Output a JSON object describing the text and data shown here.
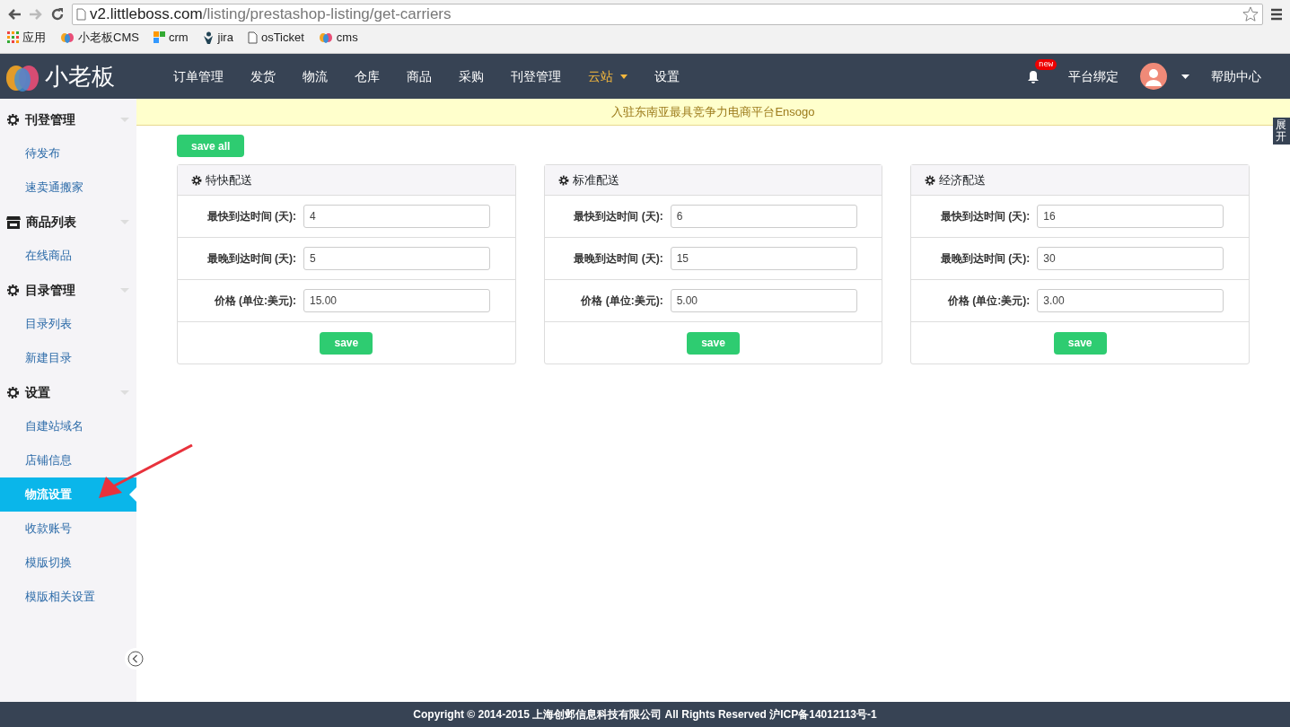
{
  "browser": {
    "url_host": "v2.littleboss.com",
    "url_path": "/listing/prestashop-listing/get-carriers",
    "bookmarks": [
      {
        "kind": "apps",
        "label": "应用"
      },
      {
        "kind": "logo",
        "label": "小老板CMS"
      },
      {
        "kind": "blocks",
        "label": "crm"
      },
      {
        "kind": "mascot",
        "label": "jira"
      },
      {
        "kind": "page",
        "label": "osTicket"
      },
      {
        "kind": "logo",
        "label": "cms"
      }
    ]
  },
  "navbar": {
    "logo_text": "小老板",
    "menu": [
      {
        "label": "订单管理",
        "selected": false,
        "dropdown": false
      },
      {
        "label": "发货",
        "selected": false,
        "dropdown": false
      },
      {
        "label": "物流",
        "selected": false,
        "dropdown": false
      },
      {
        "label": "仓库",
        "selected": false,
        "dropdown": false
      },
      {
        "label": "商品",
        "selected": false,
        "dropdown": false
      },
      {
        "label": "采购",
        "selected": false,
        "dropdown": false
      },
      {
        "label": "刊登管理",
        "selected": false,
        "dropdown": false
      },
      {
        "label": "云站",
        "selected": true,
        "dropdown": true
      },
      {
        "label": "设置",
        "selected": false,
        "dropdown": false
      }
    ],
    "notification_badge": "new",
    "platform_link": "平台绑定",
    "help_link": "帮助中心"
  },
  "banner": "入驻东南亚最具竞争力电商平台Ensogo",
  "side_tab": "展开",
  "sidebar": [
    {
      "kind": "gear",
      "title": "刊登管理",
      "items": [
        {
          "label": "待发布",
          "selected": false
        },
        {
          "label": "速卖通搬家",
          "selected": false
        }
      ]
    },
    {
      "kind": "store",
      "title": "商品列表",
      "items": [
        {
          "label": "在线商品",
          "selected": false
        }
      ]
    },
    {
      "kind": "gear",
      "title": "目录管理",
      "items": [
        {
          "label": "目录列表",
          "selected": false
        },
        {
          "label": "新建目录",
          "selected": false
        }
      ]
    },
    {
      "kind": "gear",
      "title": "设置",
      "items": [
        {
          "label": "自建站域名",
          "selected": false
        },
        {
          "label": "店铺信息",
          "selected": false
        },
        {
          "label": "物流设置",
          "selected": true
        },
        {
          "label": "收款账号",
          "selected": false
        },
        {
          "label": "模版切换",
          "selected": false
        },
        {
          "label": "模版相关设置",
          "selected": false
        }
      ]
    }
  ],
  "save_all": "save all",
  "carriers": [
    {
      "title": "特快配送",
      "button": "save",
      "fields": [
        {
          "label": "最快到达时间 (天):",
          "value": "4"
        },
        {
          "label": "最晚到达时间 (天):",
          "value": "5"
        },
        {
          "label": "价格 (单位:美元):",
          "value": "15.00"
        }
      ]
    },
    {
      "title": "标准配送",
      "button": "save",
      "fields": [
        {
          "label": "最快到达时间 (天):",
          "value": "6"
        },
        {
          "label": "最晚到达时间 (天):",
          "value": "15"
        },
        {
          "label": "价格 (单位:美元):",
          "value": "5.00"
        }
      ]
    },
    {
      "title": "经济配送",
      "button": "save",
      "fields": [
        {
          "label": "最快到达时间 (天):",
          "value": "16"
        },
        {
          "label": "最晚到达时间 (天):",
          "value": "30"
        },
        {
          "label": "价格 (单位:美元):",
          "value": "3.00"
        }
      ]
    }
  ],
  "footer": "Copyright © 2014-2015 上海创邺信息科技有限公司 All Rights Reserved 沪ICP备14012113号-1"
}
